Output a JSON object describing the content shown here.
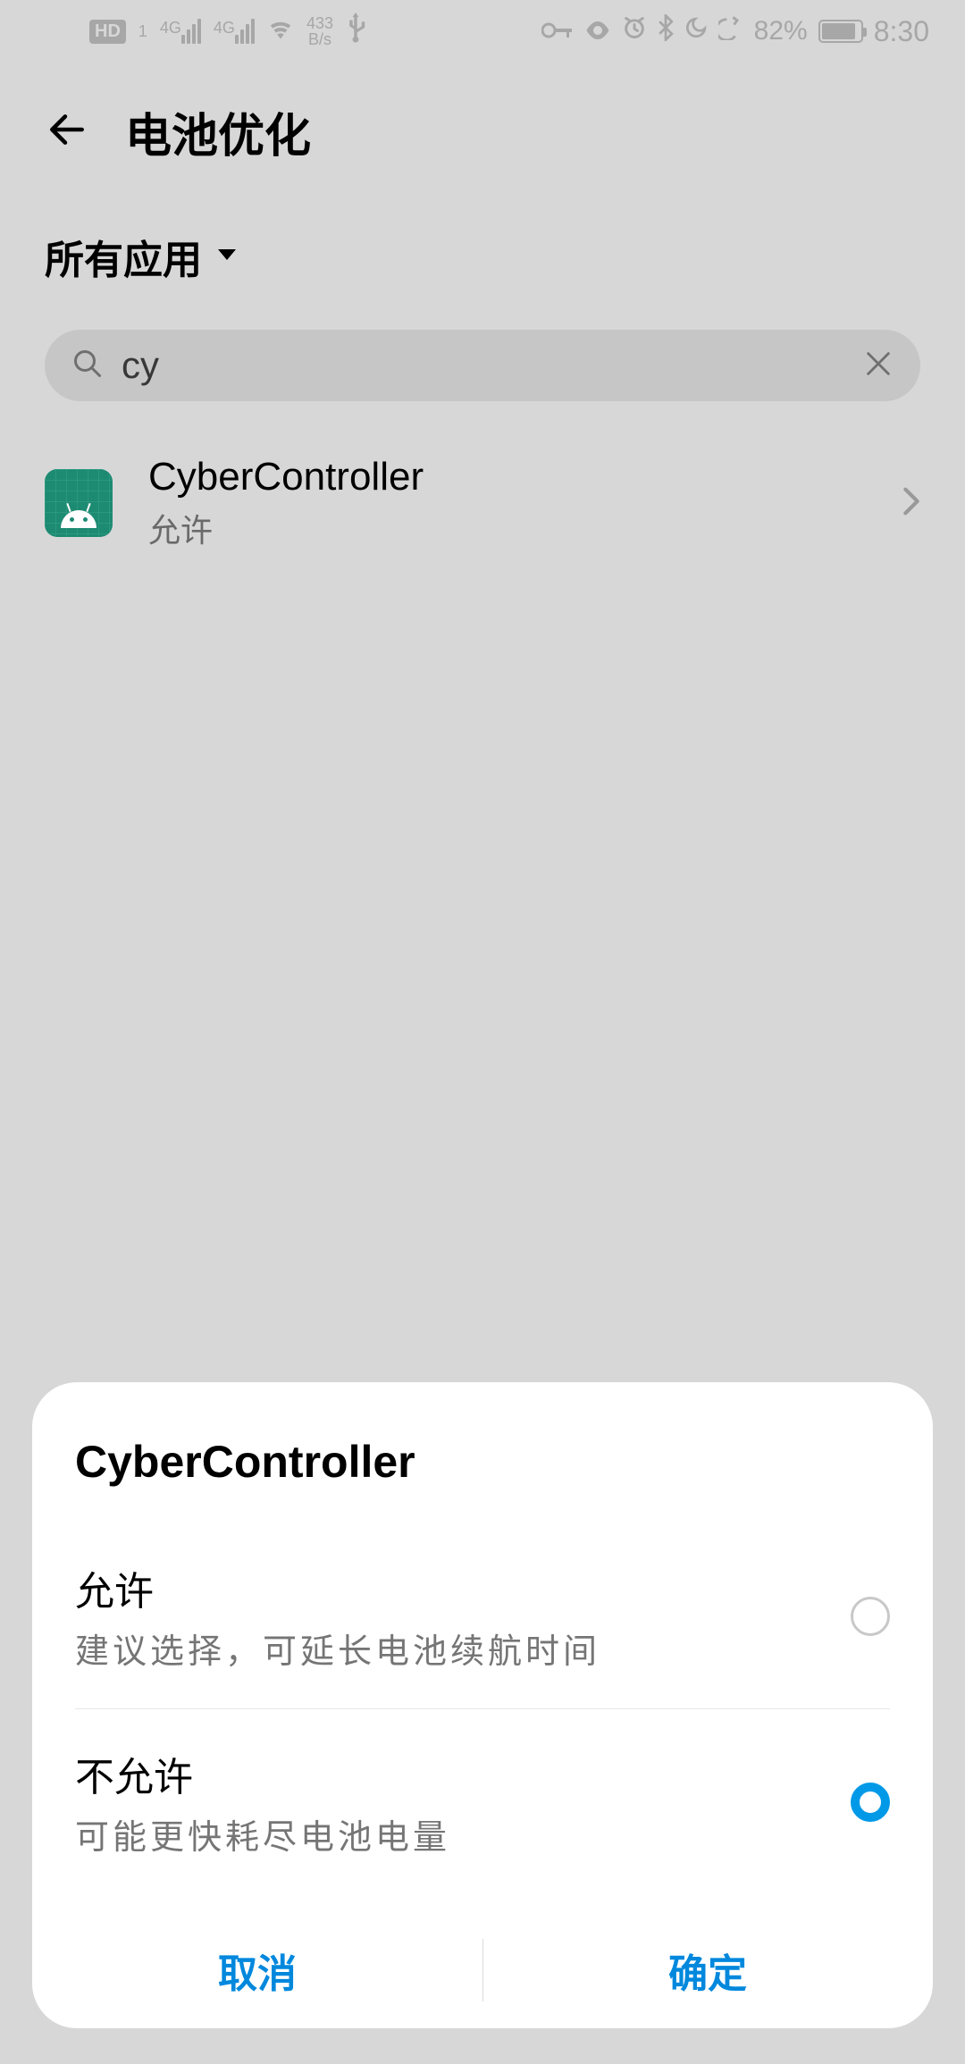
{
  "status": {
    "hd": "HD",
    "net": "4G",
    "speed_top": "433",
    "speed_bottom": "B/s",
    "battery": "82%",
    "time": "8:30"
  },
  "header": {
    "title": "电池优化",
    "filter": "所有应用"
  },
  "search": {
    "query": "cy"
  },
  "list": {
    "item0": {
      "name": "CyberController",
      "status": "允许"
    }
  },
  "dialog": {
    "title": "CyberController",
    "option0": {
      "label": "允许",
      "desc": "建议选择，可延长电池续航时间"
    },
    "option1": {
      "label": "不允许",
      "desc": "可能更快耗尽电池电量"
    },
    "cancel": "取消",
    "confirm": "确定"
  }
}
